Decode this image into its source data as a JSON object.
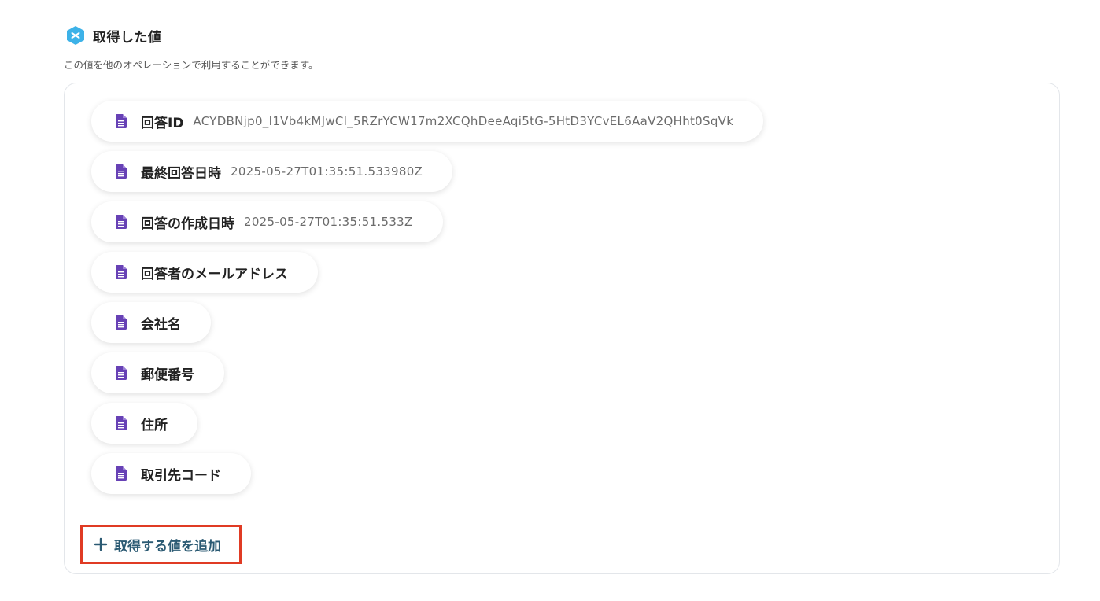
{
  "section": {
    "icon": "hexagon-logo-icon",
    "title": "取得した値",
    "description": "この値を他のオペレーションで利用することができます。"
  },
  "fields": [
    {
      "label": "回答ID",
      "value": "ACYDBNjp0_I1Vb4kMJwCl_5RZrYCW17m2XCQhDeeAqi5tG-5HtD3YCvEL6AaV2QHht0SqVk"
    },
    {
      "label": "最終回答日時",
      "value": "2025-05-27T01:35:51.533980Z"
    },
    {
      "label": "回答の作成日時",
      "value": "2025-05-27T01:35:51.533Z"
    },
    {
      "label": "回答者のメールアドレス",
      "value": ""
    },
    {
      "label": "会社名",
      "value": ""
    },
    {
      "label": "郵便番号",
      "value": ""
    },
    {
      "label": "住所",
      "value": ""
    },
    {
      "label": "取引先コード",
      "value": ""
    }
  ],
  "add_button": {
    "label": "取得する値を追加",
    "icon": "plus-icon"
  },
  "colors": {
    "doc_icon": "#6741b5",
    "accent_text": "#2b5a73",
    "highlight_border": "#e03b24",
    "logo": "#3db2e8"
  }
}
